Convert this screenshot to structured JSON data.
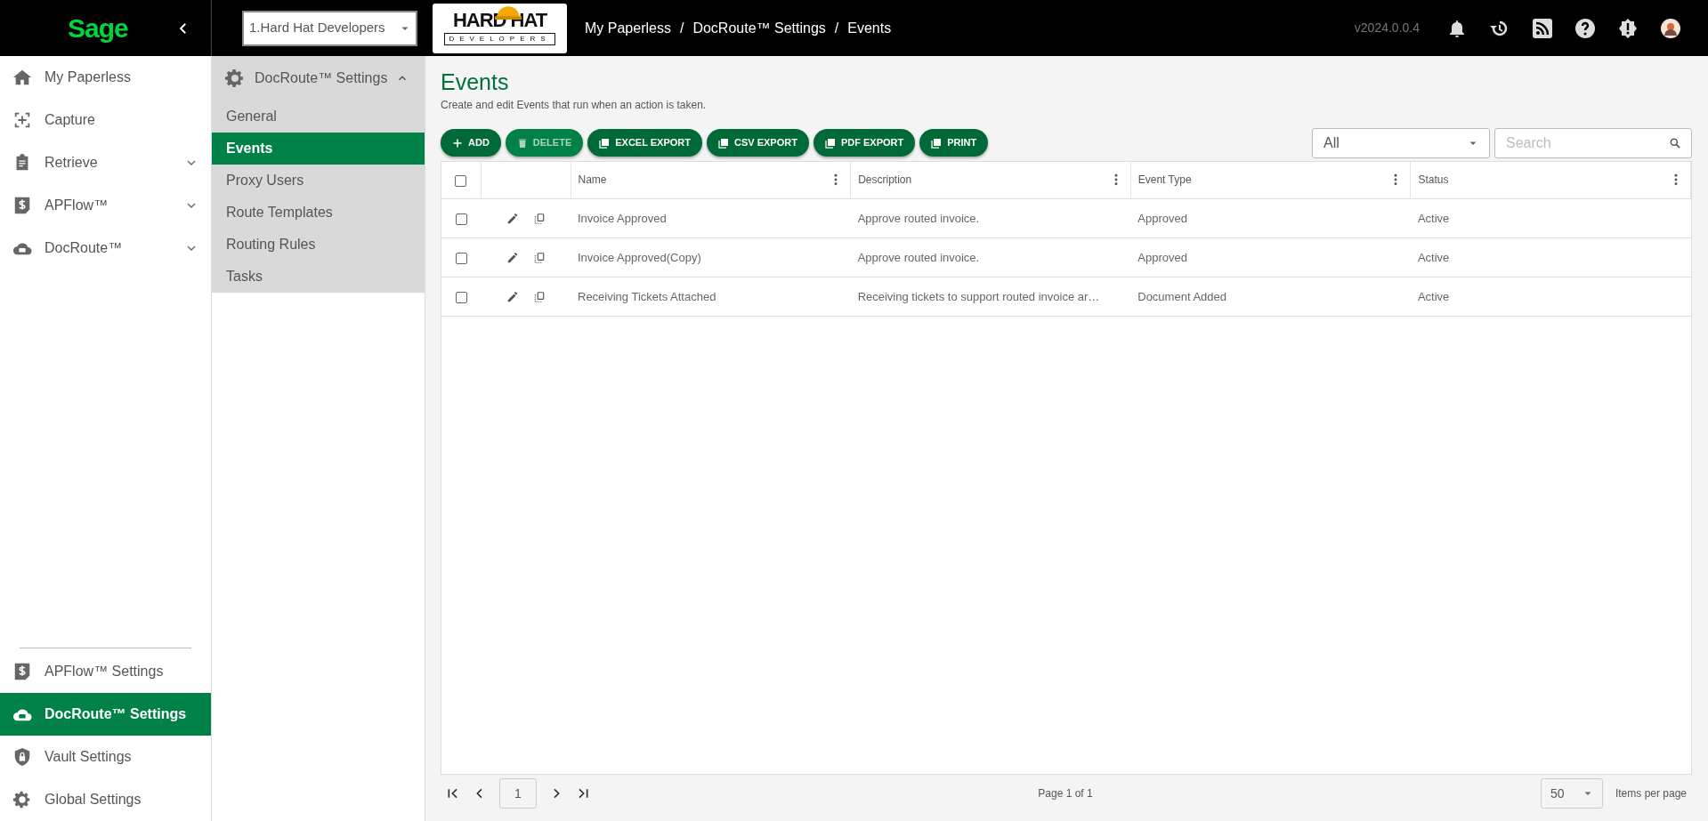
{
  "brand": {
    "name": "Sage"
  },
  "company_select": {
    "value": "1.Hard Hat Developers"
  },
  "logo": {
    "top": "HARD HAT",
    "bottom": "DEVELOPERS"
  },
  "breadcrumb": {
    "items": [
      "My Paperless",
      "DocRoute™ Settings",
      "Events"
    ],
    "separators": [
      "/",
      "/"
    ]
  },
  "version": "v2024.0.0.4",
  "sidebar": {
    "items": [
      {
        "label": "My Paperless",
        "expandable": false,
        "selected": false
      },
      {
        "label": "Capture",
        "expandable": false,
        "selected": false
      },
      {
        "label": "Retrieve",
        "expandable": true,
        "selected": false
      },
      {
        "label": "APFlow™",
        "expandable": true,
        "selected": false
      },
      {
        "label": "DocRoute™",
        "expandable": true,
        "selected": false
      }
    ],
    "settings": [
      {
        "label": "APFlow™ Settings",
        "selected": false
      },
      {
        "label": "DocRoute™ Settings",
        "selected": true
      },
      {
        "label": "Vault Settings",
        "selected": false
      },
      {
        "label": "Global Settings",
        "selected": false
      }
    ]
  },
  "submenu": {
    "title": "DocRoute™ Settings",
    "expanded": true,
    "items": [
      {
        "label": "General",
        "selected": false
      },
      {
        "label": "Events",
        "selected": true
      },
      {
        "label": "Proxy Users",
        "selected": false
      },
      {
        "label": "Route Templates",
        "selected": false
      },
      {
        "label": "Routing Rules",
        "selected": false
      },
      {
        "label": "Tasks",
        "selected": false
      }
    ]
  },
  "page": {
    "title": "Events",
    "subtitle": "Create and edit Events that run when an action is taken."
  },
  "toolbar": [
    {
      "label": "ADD",
      "disabled": false
    },
    {
      "label": "DELETE",
      "disabled": true
    },
    {
      "label": "EXCEL EXPORT",
      "disabled": false
    },
    {
      "label": "CSV EXPORT",
      "disabled": false
    },
    {
      "label": "PDF EXPORT",
      "disabled": false
    },
    {
      "label": "PRINT",
      "disabled": false
    }
  ],
  "filter": {
    "value": "All"
  },
  "search": {
    "placeholder": "Search"
  },
  "table": {
    "all_checked": false,
    "columns": [
      "Name",
      "Description",
      "Event Type",
      "Status"
    ],
    "rows": [
      {
        "checked": false,
        "cells": [
          "Invoice Approved",
          "Approve routed invoice.",
          "Approved",
          "Active"
        ]
      },
      {
        "checked": false,
        "cells": [
          "Invoice Approved(Copy)",
          "Approve routed invoice.",
          "Approved",
          "Active"
        ]
      },
      {
        "checked": false,
        "cells": [
          "Receiving Tickets Attached",
          "Receiving tickets to support routed invoice ar…",
          "Document Added",
          "Active"
        ]
      }
    ]
  },
  "pager": {
    "page": "1",
    "info": "Page 1 of 1",
    "page_size": "50",
    "page_size_label": "Items per page"
  }
}
